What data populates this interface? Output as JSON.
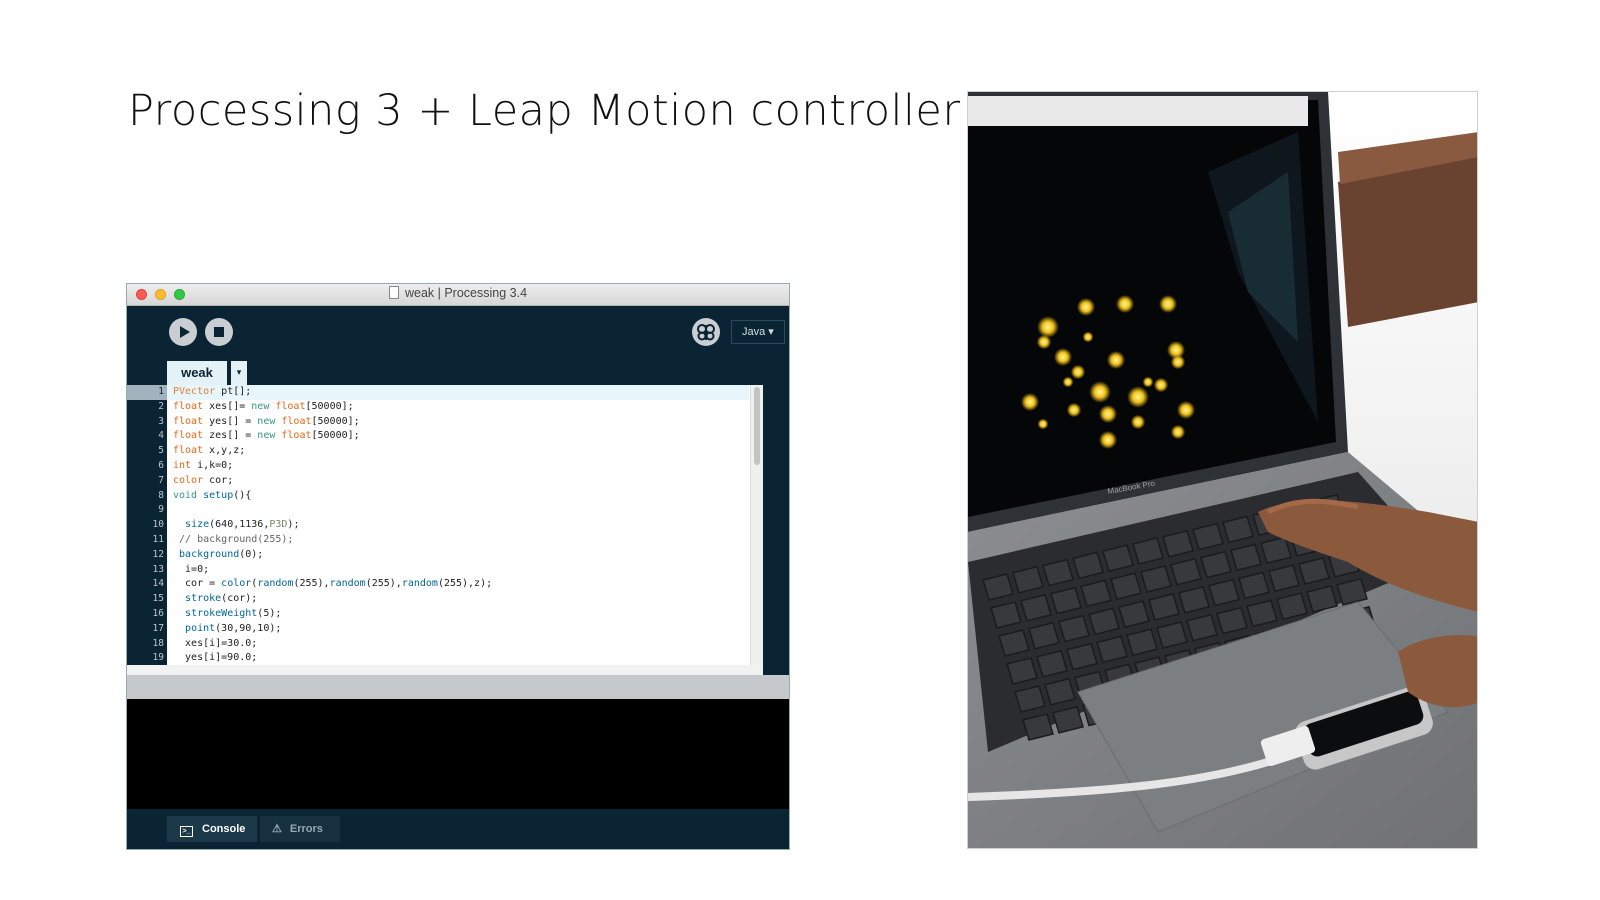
{
  "slide": {
    "title": "Processing 3 + Leap Motion controller"
  },
  "window": {
    "title": "weak | Processing 3.4",
    "mode": "Java ▾",
    "tab": "weak",
    "tab_menu": "▾"
  },
  "icons": {
    "close": "close-traffic-light",
    "minimize": "minimize-traffic-light",
    "zoom": "zoom-traffic-light",
    "run": "play-icon",
    "stop": "stop-icon",
    "debug": "butterfly-icon",
    "console": "terminal-icon",
    "errors": "warning-icon"
  },
  "editor": {
    "line_numbers": [
      "1",
      "2",
      "3",
      "4",
      "5",
      "6",
      "7",
      "8",
      "9",
      "10",
      "11",
      "12",
      "13",
      "14",
      "15",
      "16",
      "17",
      "18",
      "19"
    ],
    "lines": [
      [
        {
          "t": "PVector",
          "c": "#e57d3a"
        },
        {
          "t": " pt[];",
          "c": "#222"
        }
      ],
      [
        {
          "t": "float",
          "c": "#e2661a"
        },
        {
          "t": " xes[]= ",
          "c": "#222"
        },
        {
          "t": "new",
          "c": "#33997e"
        },
        {
          "t": " ",
          "c": "#222"
        },
        {
          "t": "float",
          "c": "#e2661a"
        },
        {
          "t": "[50000];",
          "c": "#222"
        }
      ],
      [
        {
          "t": "float",
          "c": "#e2661a"
        },
        {
          "t": " yes[] = ",
          "c": "#222"
        },
        {
          "t": "new",
          "c": "#33997e"
        },
        {
          "t": " ",
          "c": "#222"
        },
        {
          "t": "float",
          "c": "#e2661a"
        },
        {
          "t": "[50000];",
          "c": "#222"
        }
      ],
      [
        {
          "t": "float",
          "c": "#e2661a"
        },
        {
          "t": " zes[] = ",
          "c": "#222"
        },
        {
          "t": "new",
          "c": "#33997e"
        },
        {
          "t": " ",
          "c": "#222"
        },
        {
          "t": "float",
          "c": "#e2661a"
        },
        {
          "t": "[50000];",
          "c": "#222"
        }
      ],
      [
        {
          "t": "float",
          "c": "#e2661a"
        },
        {
          "t": " x,y,z;",
          "c": "#222"
        }
      ],
      [
        {
          "t": "int",
          "c": "#e2661a"
        },
        {
          "t": " i,k=0;",
          "c": "#222"
        }
      ],
      [
        {
          "t": "color",
          "c": "#e2661a"
        },
        {
          "t": " cor;",
          "c": "#222"
        }
      ],
      [
        {
          "t": "void",
          "c": "#33997e"
        },
        {
          "t": " ",
          "c": "#222"
        },
        {
          "t": "setup",
          "c": "#006699"
        },
        {
          "t": "(){",
          "c": "#222"
        }
      ],
      [
        {
          "t": "",
          "c": "#222"
        }
      ],
      [
        {
          "t": "  ",
          "c": "#222"
        },
        {
          "t": "size",
          "c": "#006699"
        },
        {
          "t": "(640,1136,",
          "c": "#222"
        },
        {
          "t": "P3D",
          "c": "#718a62"
        },
        {
          "t": ");",
          "c": "#222"
        }
      ],
      [
        {
          "t": " // background(255);",
          "c": "#666666"
        }
      ],
      [
        {
          "t": " ",
          "c": "#222"
        },
        {
          "t": "background",
          "c": "#006699"
        },
        {
          "t": "(0);",
          "c": "#222"
        }
      ],
      [
        {
          "t": "  i=0;",
          "c": "#222"
        }
      ],
      [
        {
          "t": "  cor = ",
          "c": "#222"
        },
        {
          "t": "color",
          "c": "#006699"
        },
        {
          "t": "(",
          "c": "#222"
        },
        {
          "t": "random",
          "c": "#006699"
        },
        {
          "t": "(255),",
          "c": "#222"
        },
        {
          "t": "random",
          "c": "#006699"
        },
        {
          "t": "(255),",
          "c": "#222"
        },
        {
          "t": "random",
          "c": "#006699"
        },
        {
          "t": "(255),z);",
          "c": "#222"
        }
      ],
      [
        {
          "t": "  ",
          "c": "#222"
        },
        {
          "t": "stroke",
          "c": "#006699"
        },
        {
          "t": "(cor);",
          "c": "#222"
        }
      ],
      [
        {
          "t": "  ",
          "c": "#222"
        },
        {
          "t": "strokeWeight",
          "c": "#006699"
        },
        {
          "t": "(5);",
          "c": "#222"
        }
      ],
      [
        {
          "t": "  ",
          "c": "#222"
        },
        {
          "t": "point",
          "c": "#006699"
        },
        {
          "t": "(30,90,10);",
          "c": "#222"
        }
      ],
      [
        {
          "t": "  xes[i]=30.0;",
          "c": "#222"
        }
      ],
      [
        {
          "t": "  yes[i]=90.0;",
          "c": "#222"
        }
      ]
    ]
  },
  "footer": {
    "console_label": "Console",
    "errors_label": "Errors"
  },
  "photo": {
    "laptop_label": "MacBook Pro"
  },
  "colors": {
    "editor_bg": "#0b2433",
    "tab_bg": "#e4f2f7",
    "keyword": "#e2661a",
    "function": "#006699"
  }
}
